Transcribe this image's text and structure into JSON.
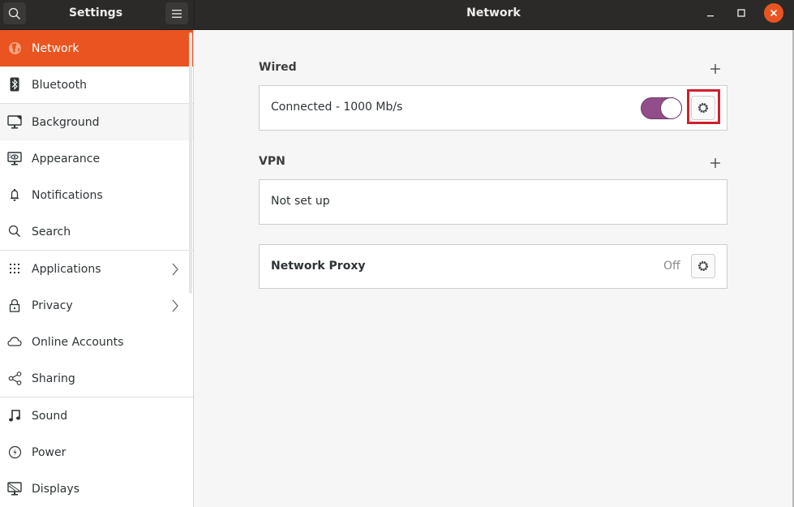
{
  "sidebar_header": {
    "title": "Settings",
    "search_icon": "search-icon",
    "menu_icon": "hamburger-menu-icon"
  },
  "content_header": {
    "title": "Network",
    "minimize_icon": "minimize-icon",
    "maximize_icon": "maximize-icon",
    "close_icon": "close-icon"
  },
  "sidebar": {
    "items": [
      {
        "label": "Network",
        "icon": "network-globe-icon",
        "active": true
      },
      {
        "label": "Bluetooth",
        "icon": "bluetooth-icon"
      },
      {
        "label": "Background",
        "icon": "background-icon"
      },
      {
        "label": "Appearance",
        "icon": "appearance-icon"
      },
      {
        "label": "Notifications",
        "icon": "bell-icon"
      },
      {
        "label": "Search",
        "icon": "search-icon"
      },
      {
        "label": "Applications",
        "icon": "apps-grid-icon",
        "has_submenu": true
      },
      {
        "label": "Privacy",
        "icon": "lock-icon",
        "has_submenu": true
      },
      {
        "label": "Online Accounts",
        "icon": "cloud-icon"
      },
      {
        "label": "Sharing",
        "icon": "share-icon"
      },
      {
        "label": "Sound",
        "icon": "music-note-icon"
      },
      {
        "label": "Power",
        "icon": "power-icon"
      },
      {
        "label": "Displays",
        "icon": "display-icon"
      }
    ]
  },
  "wired": {
    "title": "Wired",
    "add_icon": "plus-icon",
    "status": "Connected - 1000 Mb/s",
    "switch_on": true,
    "settings_icon": "gear-icon"
  },
  "vpn": {
    "title": "VPN",
    "add_icon": "plus-icon",
    "status": "Not set up"
  },
  "proxy": {
    "title": "Network Proxy",
    "state": "Off",
    "settings_icon": "gear-icon"
  },
  "colors": {
    "accent": "#e95420",
    "switch_on": "#924d8b",
    "highlight": "#d0202a"
  }
}
